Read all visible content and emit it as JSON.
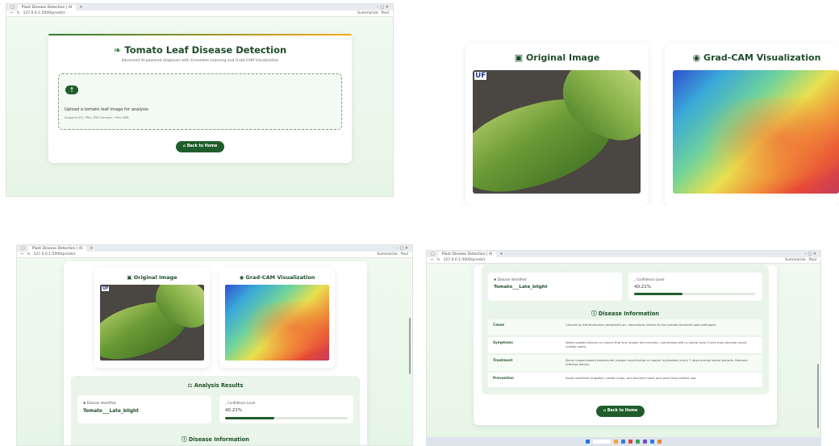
{
  "browser": {
    "tab_title": "Plant Disease Detection | AI",
    "url": "127.0.0.1:5000/predict",
    "summarize": "Summarize",
    "profile": "Paul"
  },
  "app": {
    "title": "Tomato Leaf Disease Detection",
    "subtitle": "Advanced AI-powered diagnosis with Ensemble Learning and Grad-CAM Visualization",
    "upload_prompt": "Upload a tomato leaf image for analysis",
    "upload_formats": "Supports JPG, PNG, JPEG formats • Max 5MB",
    "back_button": "Back to Home"
  },
  "images": {
    "original_title": "Original Image",
    "gradcam_title": "Grad-CAM Visualization",
    "logo_text": "UF"
  },
  "results": {
    "title": "Analysis Results",
    "disease_label": "Disease Identified",
    "disease_value": "Tomato___Late_blight",
    "confidence_label": "Confidence Level",
    "confidence_value": "40.21%",
    "confidence_fraction": 0.4021
  },
  "info": {
    "title": "Disease Information",
    "rows": [
      {
        "key": "Cause",
        "value": "Caused by Xanthomonas campestris pv. vesicatoria similar to the tomato bacterial spot pathogen."
      },
      {
        "key": "Symptoms",
        "value": "Water-soaked lesions on leaves that turn brown and necrotic, sometimes with a yellow halo. Fruits may develop small, scabby spots."
      },
      {
        "key": "Treatment",
        "value": "Spray copper-based bactericide (copper oxychloride or copper hydroxide) every 7 days during humid periods. Remove infected leaves."
      },
      {
        "key": "Prevention",
        "value": "Avoid overhead irrigation, rotate crops, and disinfect tools and seed trays before use."
      }
    ]
  },
  "colors": {
    "accent": "#1f5e2c",
    "page_bg": "#eef7ee"
  }
}
